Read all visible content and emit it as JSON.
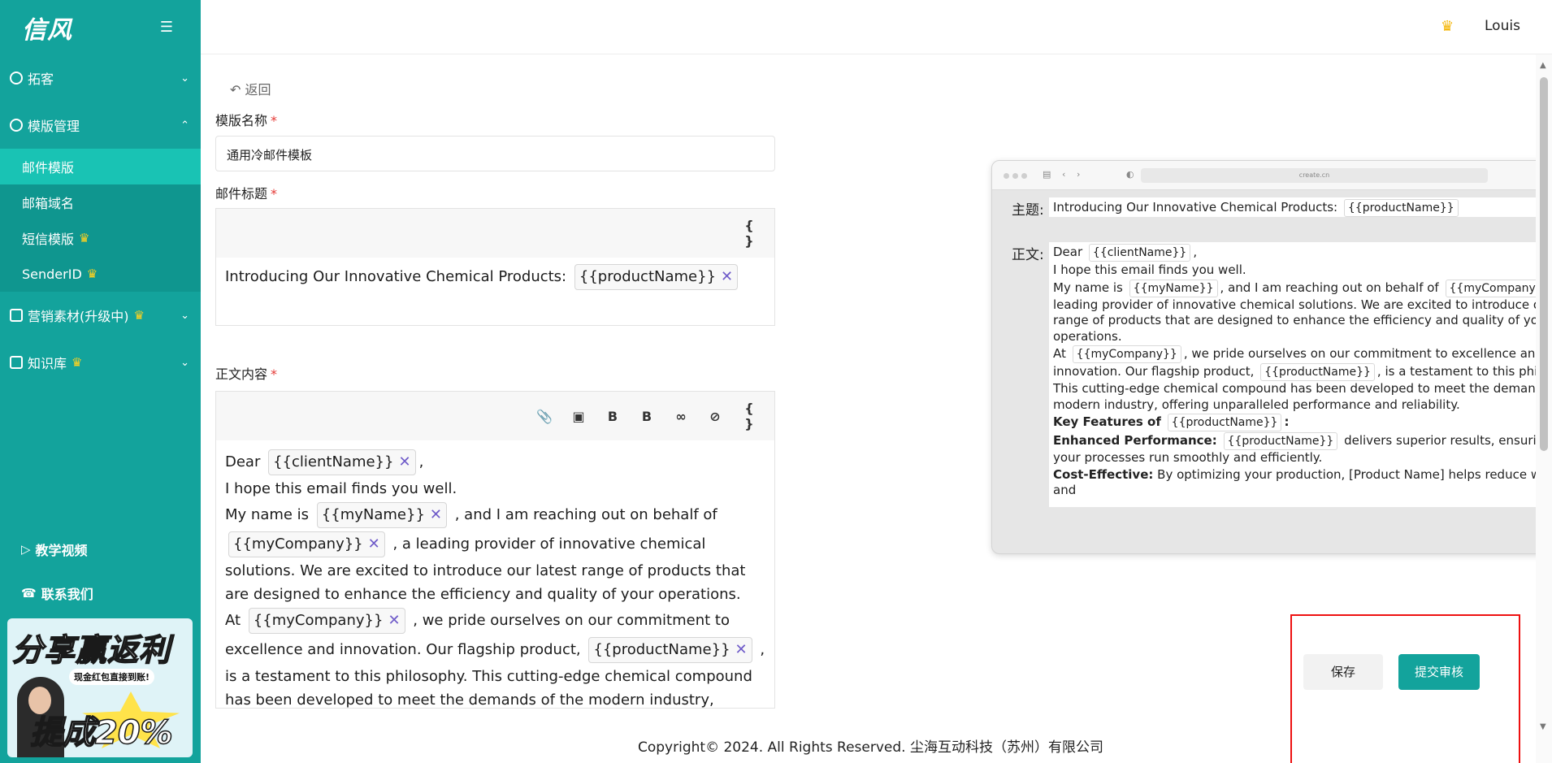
{
  "app": {
    "logo": "信风",
    "user": "Louis"
  },
  "sidebar": {
    "groups": [
      {
        "label": "拓客"
      },
      {
        "label": "模版管理"
      },
      {
        "label": "营销素材(升级中)"
      },
      {
        "label": "知识库"
      }
    ],
    "sub_items": [
      {
        "label": "邮件模版"
      },
      {
        "label": "邮箱域名"
      },
      {
        "label": "短信模版"
      },
      {
        "label": "SenderID"
      }
    ],
    "tutorial": "教学视频",
    "contact": "联系我们",
    "promo": {
      "title": "分享赢返利",
      "subtitle": "现金红包直接到账!",
      "rate": "提成20%"
    }
  },
  "form": {
    "back": "返回",
    "template_name_label": "模版名称",
    "template_name_value": "通用冷邮件模板",
    "subject_label": "邮件标题",
    "subject_text": "Introducing Our Innovative Chemical Products:",
    "body_label": "正文内容",
    "variables": {
      "clientName": "{{clientName}}",
      "myName": "{{myName}}",
      "myCompany": "{{myCompany}}",
      "productName": "{{productName}}"
    },
    "body": {
      "dear": "Dear",
      "hope": "I hope this email finds you well.",
      "my_name_is": "My name is",
      "reaching": ", and I am reaching out on behalf of",
      "leading": ", a leading provider of innovative chemical solutions.",
      "excited": "We are excited to introduce our latest range of products that are designed to enhance the efficiency and quality of your operations.",
      "at": "At",
      "pride": ", we pride ourselves on our commitment to excellence and innovation. Our flagship product,",
      "testament": ", is a testament to this philosophy. This cutting-edge chemical compound has been developed to meet the demands of the modern industry, offering unparalleled performance and reliability.",
      "key_features": "Key Features of"
    }
  },
  "preview": {
    "url": "create.cn",
    "subject_label": "主题:",
    "body_label": "正文:",
    "enhanced_label": "Enhanced Performance:",
    "enhanced_text": "delivers superior results, ensuring that your processes run smoothly and efficiently.",
    "cost_label": "Cost-Effective:",
    "cost_text": "By optimizing your production, [Product Name] helps reduce waste and"
  },
  "actions": {
    "save": "保存",
    "submit": "提交审核"
  },
  "footer": "Copyright© 2024. All Rights Reserved. 尘海互动科技（苏州）有限公司",
  "colors": {
    "brand": "#13a39c",
    "highlight_box": "#e11111",
    "variable_remove": "#6f5bc9"
  }
}
